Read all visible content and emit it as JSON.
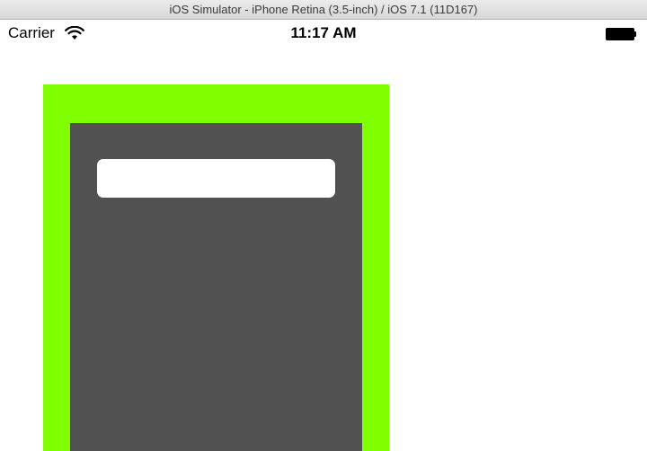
{
  "window": {
    "title": "iOS Simulator - iPhone Retina (3.5-inch) / iOS 7.1 (11D167)"
  },
  "status_bar": {
    "carrier": "Carrier",
    "time": "11:17 AM",
    "icons": {
      "signal": "wifi-icon",
      "battery": "battery-icon"
    },
    "battery_level": 1.0
  },
  "content": {
    "text_field": {
      "value": "",
      "placeholder": ""
    }
  },
  "colors": {
    "frame_background": "#80ff00",
    "panel_background": "#515151",
    "field_background": "#ffffff"
  }
}
